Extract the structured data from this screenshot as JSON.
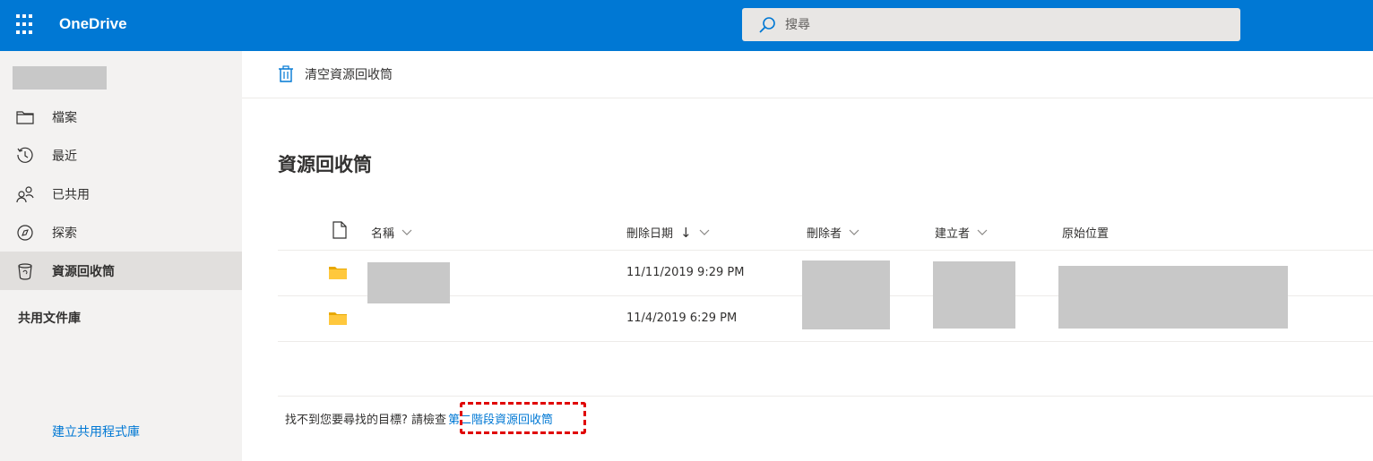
{
  "header": {
    "app_name": "OneDrive",
    "search_placeholder": "搜尋",
    "brand_color": "#0078d4"
  },
  "sidebar": {
    "items": [
      {
        "label": "檔案",
        "icon": "folder-icon"
      },
      {
        "label": "最近",
        "icon": "recent-clock-icon"
      },
      {
        "label": "已共用",
        "icon": "shared-people-icon"
      },
      {
        "label": "探索",
        "icon": "discover-compass-icon"
      },
      {
        "label": "資源回收筒",
        "icon": "recycle-bin-icon",
        "active": true
      }
    ],
    "section_title": "共用文件庫",
    "create_library_link": "建立共用程式庫"
  },
  "commandbar": {
    "empty_recycle_label": "清空資源回收筒"
  },
  "page": {
    "title": "資源回收筒"
  },
  "table": {
    "columns": {
      "name": "名稱",
      "deleted_date": "刪除日期",
      "deleted_by": "刪除者",
      "created_by": "建立者",
      "original_location": "原始位置"
    },
    "sort_indicator": "↓",
    "rows": [
      {
        "type": "folder",
        "deleted_date": "11/11/2019 9:29 PM"
      },
      {
        "type": "folder",
        "deleted_date": "11/4/2019 6:29 PM"
      }
    ]
  },
  "footer": {
    "text": "找不到您要尋找的目標? 請檢查",
    "link": "第二階段資源回收筒",
    "highlight_color": "#e00000"
  }
}
